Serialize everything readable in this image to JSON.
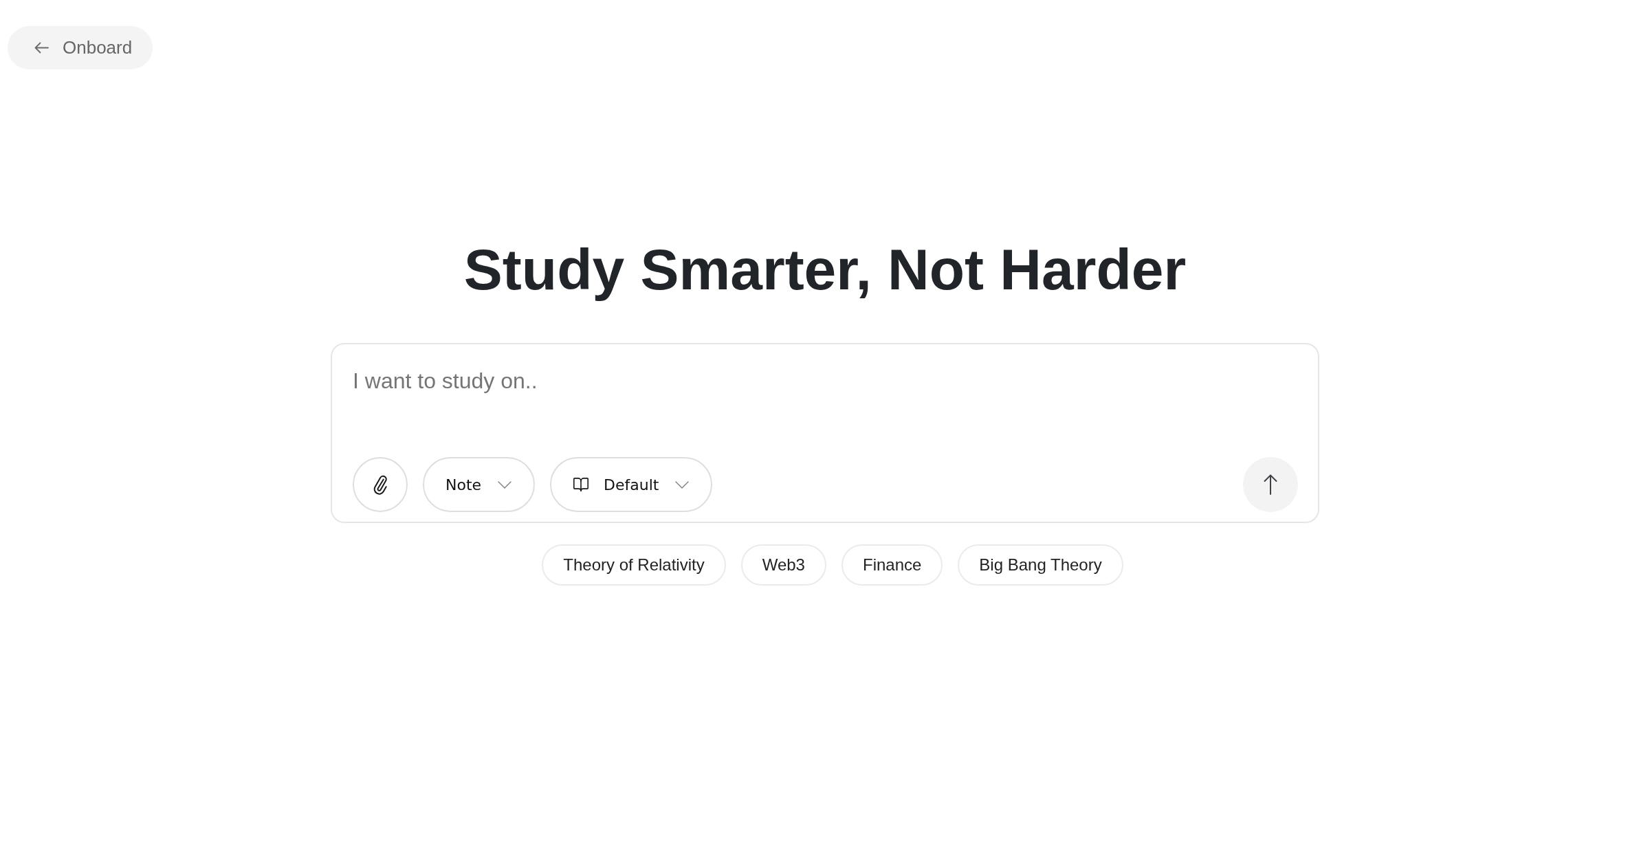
{
  "back_button": {
    "label": "Onboard"
  },
  "heading": "Study Smarter, Not Harder",
  "composer": {
    "placeholder": "I want to study on..",
    "mode_select": {
      "label": "Note"
    },
    "source_select": {
      "label": "Default"
    }
  },
  "suggestions": [
    "Theory of Relativity",
    "Web3",
    "Finance",
    "Big Bang Theory"
  ]
}
